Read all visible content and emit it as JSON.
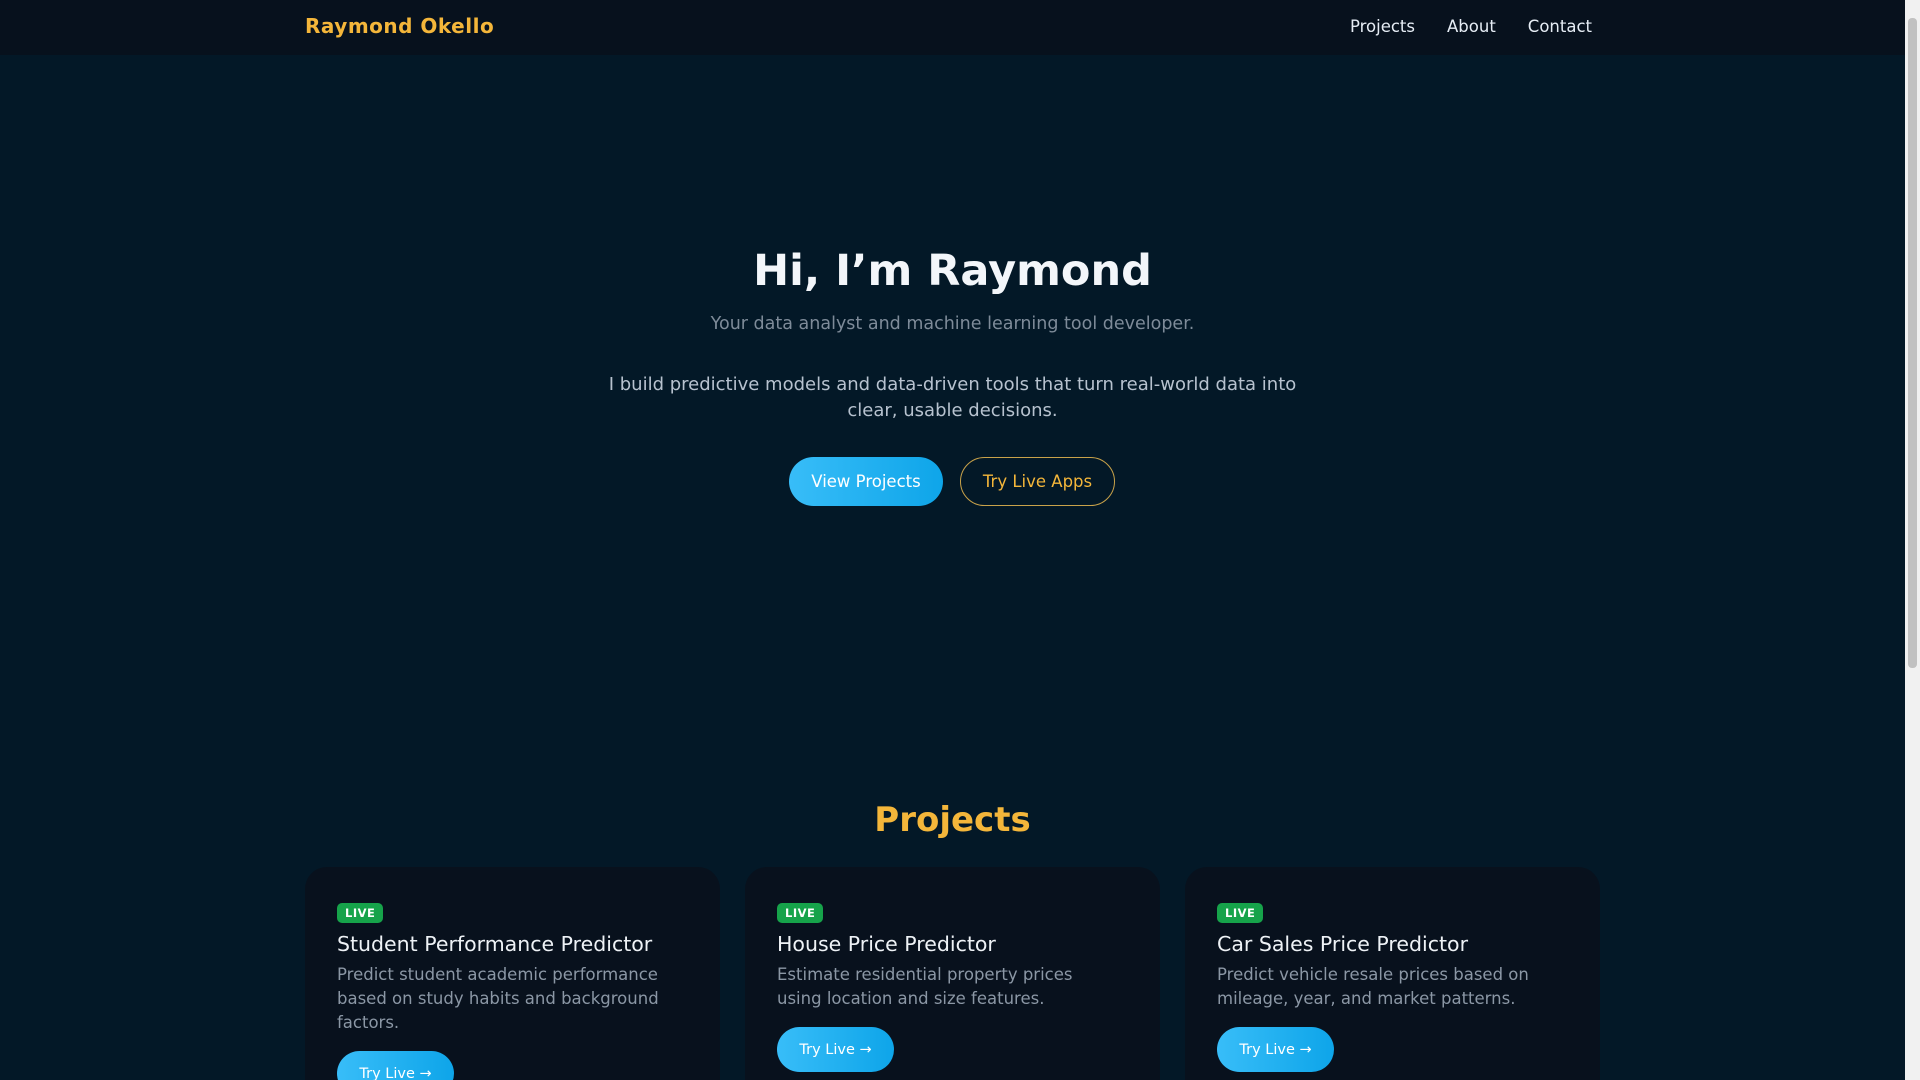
{
  "nav": {
    "brand": "Raymond Okello",
    "links": [
      "Projects",
      "About",
      "Contact"
    ]
  },
  "hero": {
    "title": "Hi, I’m Raymond",
    "subtitle": "Your data analyst and machine learning tool developer.",
    "description": "I build predictive models and data-driven tools that turn real-world data into clear, usable decisions.",
    "primary_button": "View Projects",
    "secondary_button": "Try Live Apps"
  },
  "projects": {
    "heading": "Projects",
    "cards": [
      {
        "badge": "LIVE",
        "title": "Student Performance Predictor",
        "description": "Predict student academic performance based on study habits and background factors.",
        "button": "Try Live →"
      },
      {
        "badge": "LIVE",
        "title": "House Price Predictor",
        "description": "Estimate residential property prices using location and size features.",
        "button": "Try Live →"
      },
      {
        "badge": "LIVE",
        "title": "Car Sales Price Predictor",
        "description": "Predict vehicle resale prices based on mileage, year, and market patterns.",
        "button": "Try Live →"
      }
    ]
  }
}
